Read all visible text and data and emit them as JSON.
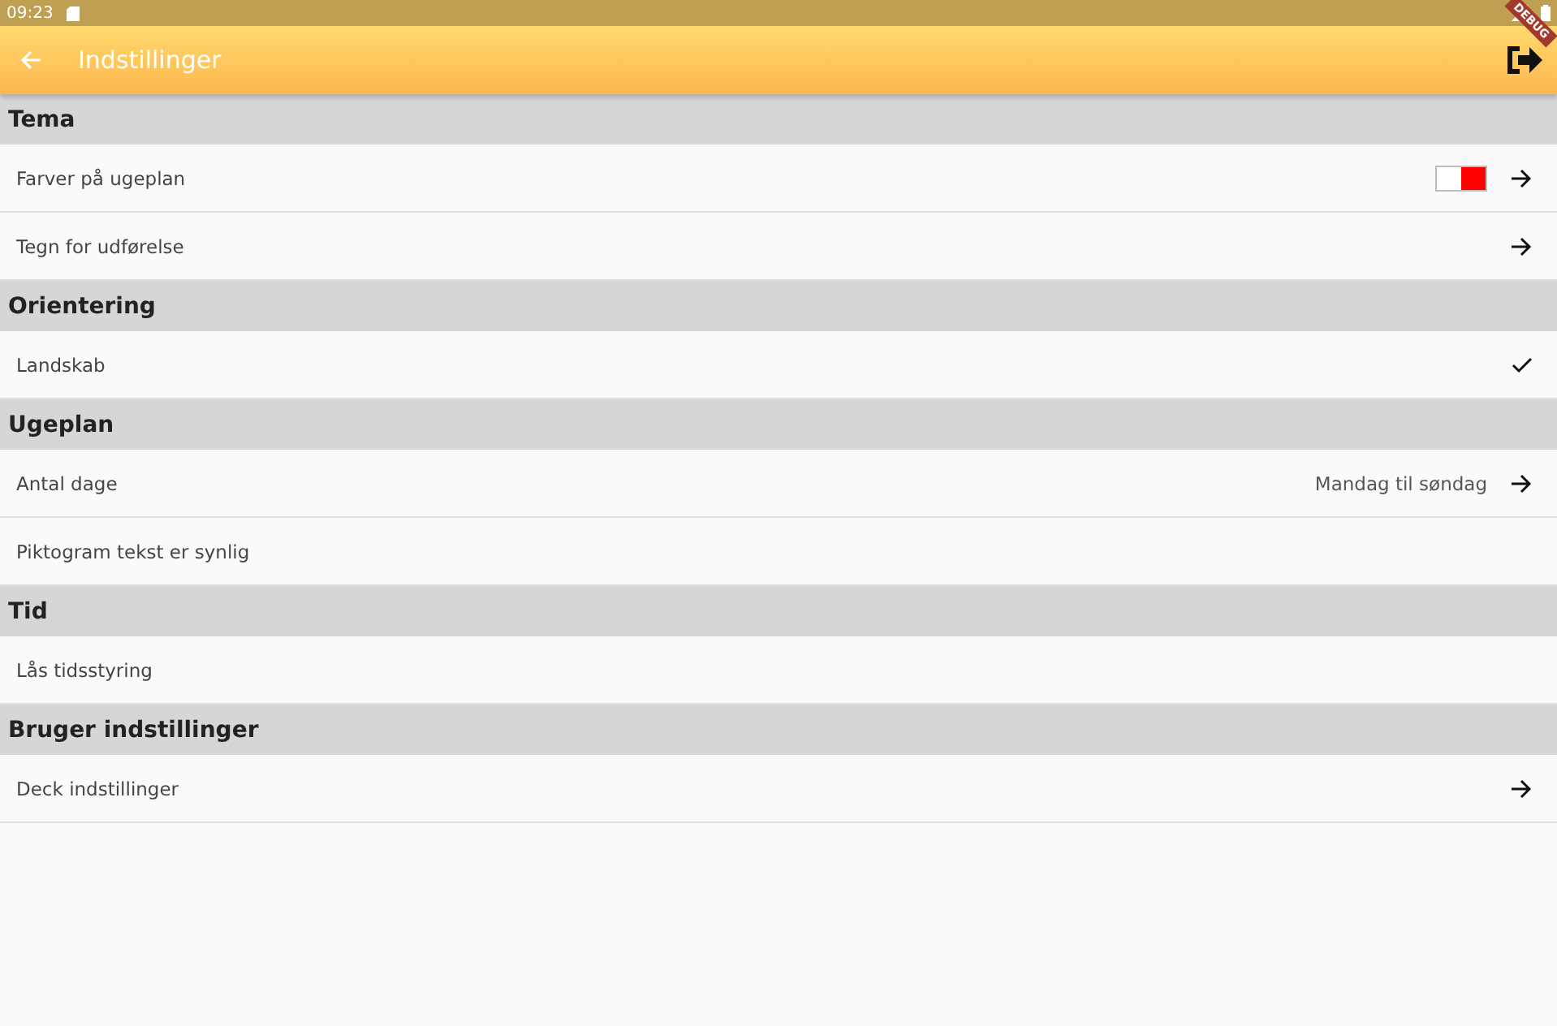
{
  "status_bar": {
    "time": "09:23"
  },
  "debug_banner": {
    "label": "DEBUG"
  },
  "app_bar": {
    "title": "Indstillinger"
  },
  "sections": [
    {
      "title": "Tema",
      "items": [
        {
          "label": "Farver på ugeplan",
          "kind": "swatch"
        },
        {
          "label": "Tegn for udførelse",
          "kind": "arrow"
        }
      ]
    },
    {
      "title": "Orientering",
      "items": [
        {
          "label": "Landskab",
          "kind": "check",
          "checked": true
        }
      ]
    },
    {
      "title": "Ugeplan",
      "items": [
        {
          "label": "Antal dage",
          "kind": "value",
          "value": "Mandag til søndag"
        },
        {
          "label": "Piktogram tekst er synlig",
          "kind": "plain"
        }
      ]
    },
    {
      "title": "Tid",
      "items": [
        {
          "label": "Lås tidsstyring",
          "kind": "plain"
        }
      ]
    },
    {
      "title": "Bruger indstillinger",
      "items": [
        {
          "label": "Deck indstillinger",
          "kind": "arrow"
        }
      ]
    }
  ]
}
